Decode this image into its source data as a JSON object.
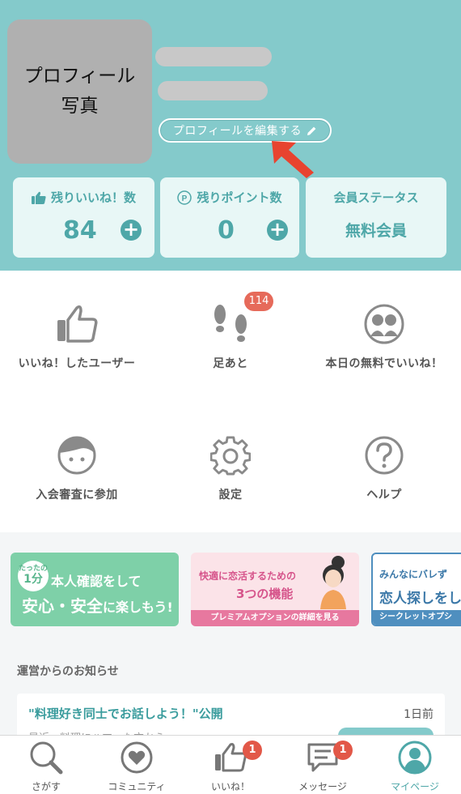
{
  "profile": {
    "photo_label": "プロフィール\n写真",
    "edit_button": "プロフィールを編集する"
  },
  "stats": {
    "likes": {
      "title": "残りいいね！数",
      "value": "84"
    },
    "points": {
      "title": "残りポイント数",
      "value": "0"
    },
    "status": {
      "title": "会員ステータス",
      "value": "無料会員"
    }
  },
  "menu": {
    "liked_users": "いいね！したユーザー",
    "footprints": "足あと",
    "footprints_badge": "114",
    "free_like": "本日の無料でいいね！",
    "screening": "入会審査に参加",
    "settings": "設定",
    "help": "ヘルプ"
  },
  "banners": {
    "verify": {
      "badge_top": "たったの",
      "badge_main": "1分",
      "line1": "本人確認をして",
      "line2a": "安心・安全",
      "line2b": "に楽しもう!"
    },
    "premium": {
      "line1": "快適に恋活するための",
      "line2": "3つの機能",
      "bar": "プレミアムオプションの詳細を見る"
    },
    "secret": {
      "line1": "みんなにバレず",
      "line2": "恋人探しをし",
      "bar": "シークレットオプシ"
    }
  },
  "news": {
    "heading": "運営からのお知らせ",
    "title": "\"料理好き同士でお話しよう！\"公開",
    "time": "1日前",
    "excerpt": "最近、料理にハマった方から..."
  },
  "tabs": [
    {
      "label": "さがす",
      "badge": ""
    },
    {
      "label": "コミュニティ",
      "badge": ""
    },
    {
      "label": "いいね！",
      "badge": "1"
    },
    {
      "label": "メッセージ",
      "badge": "1"
    },
    {
      "label": "マイページ",
      "badge": ""
    }
  ],
  "colors": {
    "header": "#84cacb",
    "accent": "#4ea7a8",
    "badge": "#e25848",
    "arrow": "#e8432f"
  }
}
